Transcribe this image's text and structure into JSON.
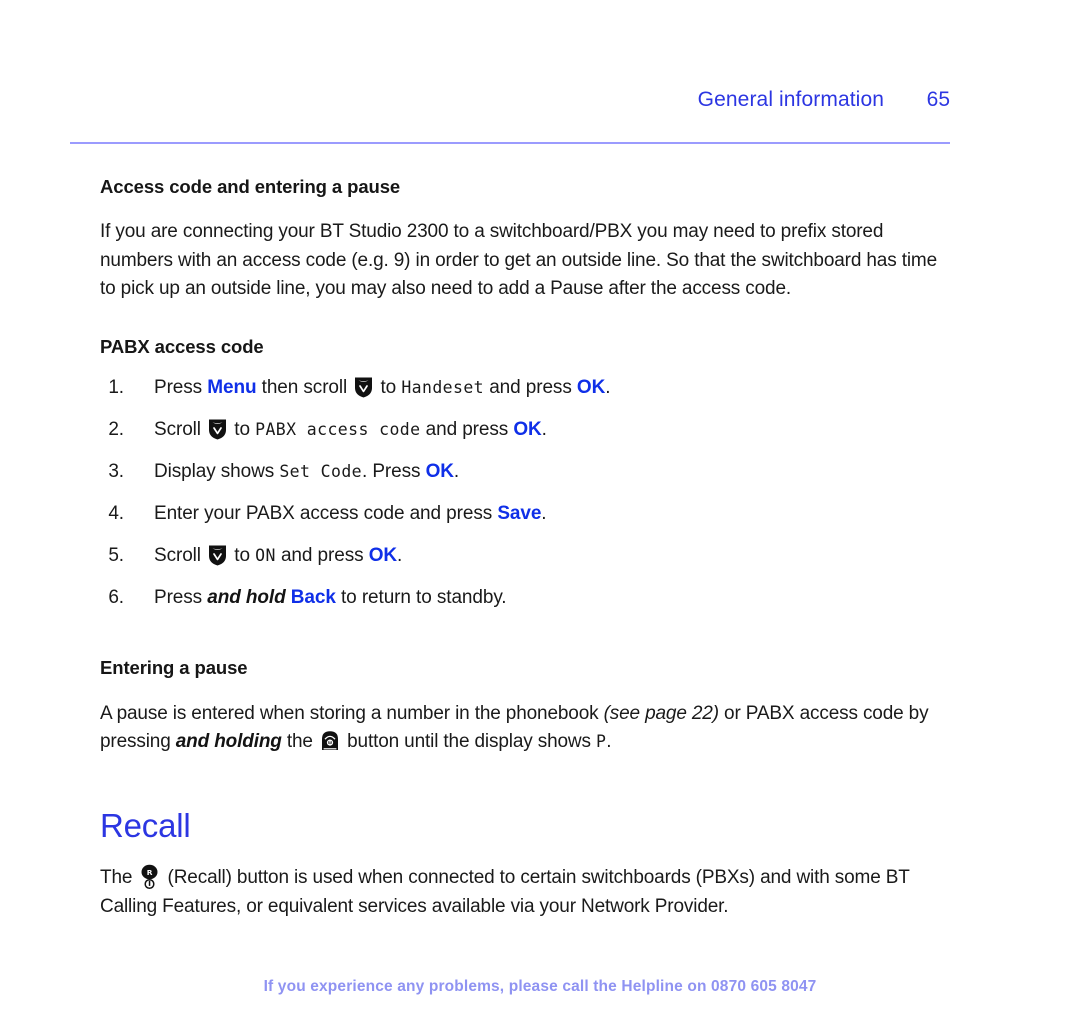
{
  "header": {
    "section_title": "General information",
    "page_number": "65",
    "rule_color": "#9b9bfe",
    "title_color": "#2c36e2"
  },
  "sections": {
    "access_code": {
      "heading": "Access code and entering a pause",
      "paragraph": "If you are connecting your BT Studio 2300 to a switchboard/PBX you may need to prefix stored numbers with an access code (e.g. 9) in order to get an outside line. So that the switchboard has time to pick up an outside line, you may also need to add a Pause after the access code."
    },
    "pabx": {
      "heading": "PABX access code",
      "steps": [
        {
          "num": "1.",
          "pre": "Press ",
          "key1": "Menu",
          "mid1": " then scroll ",
          "icon": "scroll-down-icon",
          "mid2": " to ",
          "display": "Handeset",
          "mid3": " and press ",
          "key2": "OK",
          "end": "."
        },
        {
          "num": "2.",
          "pre": "Scroll ",
          "icon": "scroll-down-icon",
          "mid2": " to ",
          "display": "PABX access code",
          "mid3": " and press ",
          "key2": "OK",
          "end": "."
        },
        {
          "num": "3.",
          "pre": "Display shows ",
          "display": "Set Code",
          "mid3": ". Press ",
          "key2": "OK",
          "end": "."
        },
        {
          "num": "4.",
          "pre": "Enter your PABX access code and press ",
          "key2": "Save",
          "end": "."
        },
        {
          "num": "5.",
          "pre": "Scroll ",
          "icon": "scroll-down-icon",
          "mid2": " to ",
          "display": "ON",
          "mid3": " and press ",
          "key2": "OK",
          "end": "."
        },
        {
          "num": "6.",
          "pre": "Press ",
          "emphasis": "and hold",
          "mid2": " ",
          "key2": "Back",
          "end": " to return to standby."
        }
      ]
    },
    "entering_pause": {
      "heading": "Entering a pause",
      "text_1": "A pause is entered when storing a number in the phonebook ",
      "reference": "(see page 22)",
      "text_2": " or PABX access code by pressing ",
      "emphasis": "and holding",
      "text_3": " the ",
      "icon": "pause-key-icon",
      "text_4": " button until the display shows ",
      "display": "P",
      "text_5": "."
    },
    "recall": {
      "heading": "Recall",
      "text_1": "The ",
      "icon": "recall-button-icon",
      "icon_label_primary": "R",
      "text_2": " (Recall) button is used when connected to certain switchboards (PBXs) and with some BT Calling Features, or equivalent services available via your Network Provider."
    }
  },
  "footer": {
    "message": "If you experience any problems, please call the Helpline on ",
    "phone": "0870 605 8047",
    "color": "#8f93f2"
  }
}
